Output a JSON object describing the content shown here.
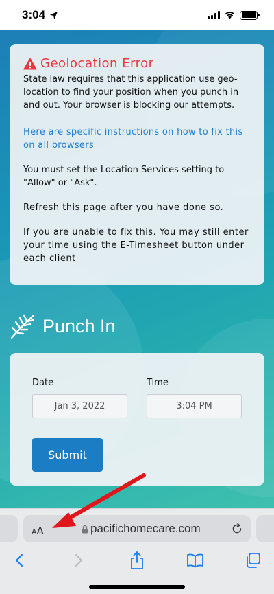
{
  "status_bar": {
    "time": "3:04",
    "location_icon": "location-arrow-icon",
    "signal_icon": "cellular-signal-icon",
    "wifi_icon": "wifi-icon",
    "battery_icon": "battery-icon"
  },
  "error_card": {
    "title": "Geolocation Error",
    "icon": "warning-triangle-icon",
    "body": "State law requires that this application use geo-location to find your position when you punch in and out. Your browser is blocking our attempts.",
    "link_text": "Here are specific instructions on how to fix this on all browsers",
    "paragraph_location": "You must set the Location Services setting to \"Allow\" or \"Ask\".",
    "paragraph_refresh": "Refresh this page after you have done so.",
    "paragraph_etimesheet": "If you are unable to fix this. You may still enter your time using the E-Timesheet button under each client",
    "colors": {
      "title": "#e5393f",
      "link": "#1e7ed0"
    }
  },
  "punch_in": {
    "title": "Punch In",
    "logo_icon": "palm-leaf-icon",
    "date_label": "Date",
    "date_value": "Jan 3, 2022",
    "time_label": "Time",
    "time_value": "3:04 PM",
    "submit_label": "Submit",
    "submit_color": "#1b7dc3"
  },
  "safari": {
    "aa_small": "A",
    "aa_big": "A",
    "url": "pacifichomecare.com",
    "lock_icon": "lock-icon",
    "reload_icon": "reload-icon",
    "toolbar": {
      "back_icon": "chevron-left-icon",
      "forward_icon": "chevron-right-icon",
      "share_icon": "share-icon",
      "bookmarks_icon": "book-icon",
      "tabs_icon": "tabs-icon"
    }
  },
  "annotation": {
    "arrow_color": "#e0161b",
    "arrow_icon": "red-arrow-icon"
  }
}
